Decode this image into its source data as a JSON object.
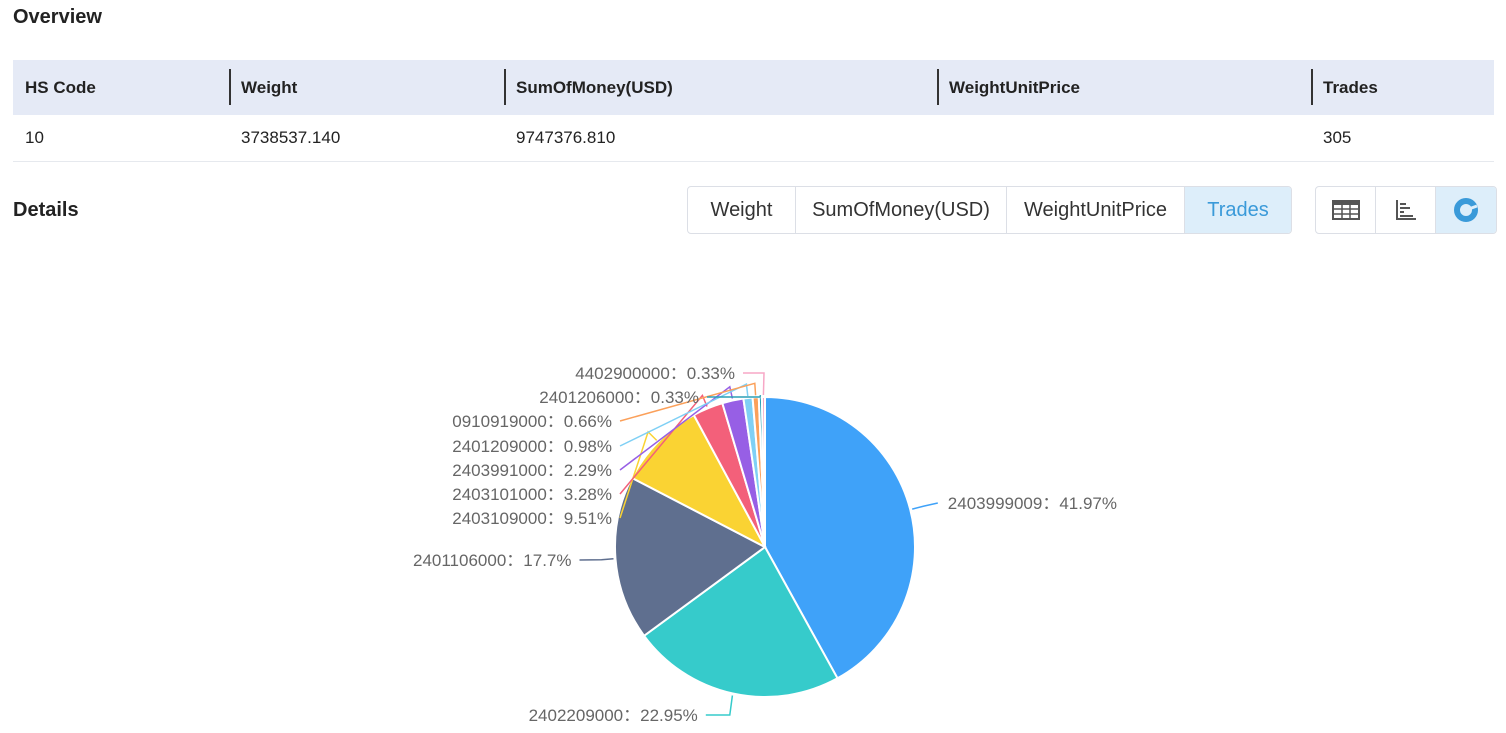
{
  "overview": {
    "title": "Overview",
    "columns": [
      "HS Code",
      "Weight",
      "SumOfMoney(USD)",
      "WeightUnitPrice",
      "Trades"
    ],
    "row": [
      "10",
      "3738537.140",
      "9747376.810",
      "",
      "305"
    ]
  },
  "details": {
    "title": "Details",
    "metric_tabs": [
      "Weight",
      "SumOfMoney(USD)",
      "WeightUnitPrice",
      "Trades"
    ],
    "active_metric": "Trades",
    "view_tabs": [
      {
        "name": "table-view",
        "icon": "table-icon"
      },
      {
        "name": "bar-view",
        "icon": "bar-chart-icon"
      },
      {
        "name": "pie-view",
        "icon": "pie-chart-icon"
      }
    ],
    "active_view": "pie-view"
  },
  "colors": {
    "accent": "#3a9ad9",
    "header_bg": "#e5eaf6",
    "active_tab_bg": "#ddeefa"
  },
  "chart_data": {
    "type": "pie",
    "label_format": "{name}：{value}%",
    "slices": [
      {
        "name": "2403999009",
        "label": "41.97%",
        "value": 41.97,
        "color": "#3fa2f9"
      },
      {
        "name": "2402209000",
        "label": "22.95%",
        "value": 22.95,
        "color": "#36cbcb"
      },
      {
        "name": "2401106000",
        "label": "17.7%",
        "value": 17.7,
        "color": "#5f6f8f"
      },
      {
        "name": "2403109000",
        "label": "9.51%",
        "value": 9.51,
        "color": "#fad333"
      },
      {
        "name": "2403101000",
        "label": "3.28%",
        "value": 3.28,
        "color": "#f3607a"
      },
      {
        "name": "2403991000",
        "label": "2.29%",
        "value": 2.29,
        "color": "#975fe5"
      },
      {
        "name": "2401209000",
        "label": "0.98%",
        "value": 0.98,
        "color": "#7fd0f5"
      },
      {
        "name": "0910919000",
        "label": "0.66%",
        "value": 0.66,
        "color": "#fba05a"
      },
      {
        "name": "2401206000",
        "label": "0.33%",
        "value": 0.33,
        "color": "#2b9fb5"
      },
      {
        "name": "4402900000",
        "label": "0.33%",
        "value": 0.33,
        "color": "#f7a7c6"
      }
    ]
  }
}
